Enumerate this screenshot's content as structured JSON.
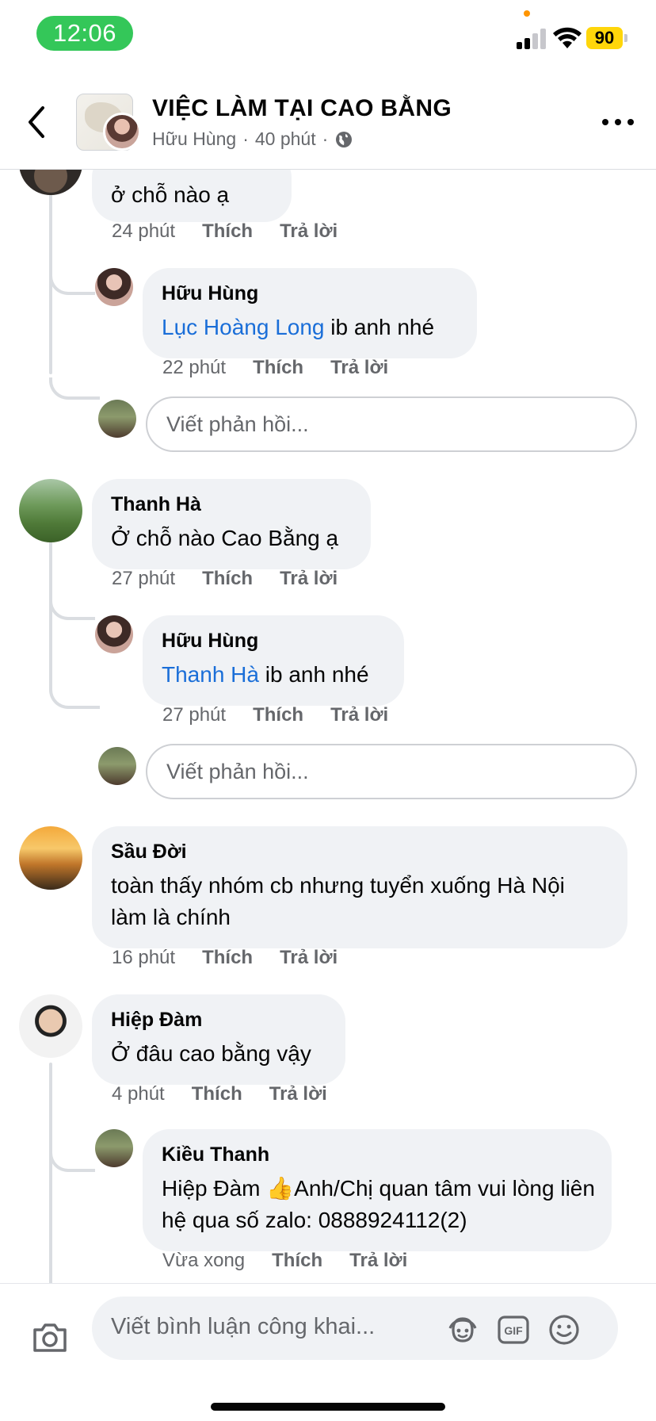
{
  "status_bar": {
    "time": "12:06",
    "battery": "90"
  },
  "header": {
    "title": "VIỆC LÀM TẠI CAO BẰNG",
    "author": "Hữu Hùng",
    "separator": "·",
    "time_ago": "40 phút",
    "separator2": "·"
  },
  "comments": {
    "c0": {
      "text": "ở chỗ nào ạ",
      "time": "24 phút",
      "like": "Thích",
      "reply": "Trả lời"
    },
    "r0": {
      "author": "Hữu Hùng",
      "mention": "Lục Hoàng Long",
      "text": " ib anh nhé",
      "time": "22 phút",
      "like": "Thích",
      "reply": "Trả lời"
    },
    "reply_box_1": {
      "placeholder": "Viết phản hồi..."
    },
    "c1": {
      "author": "Thanh Hà",
      "text": "Ở chỗ nào Cao Bằng ạ",
      "time": "27 phút",
      "like": "Thích",
      "reply": "Trả lời"
    },
    "r1": {
      "author": "Hữu Hùng",
      "mention": "Thanh Hà",
      "text": " ib anh nhé",
      "time": "27 phút",
      "like": "Thích",
      "reply": "Trả lời"
    },
    "reply_box_2": {
      "placeholder": "Viết phản hồi..."
    },
    "c2": {
      "author": "Sầu Đời",
      "text": "toàn thấy nhóm cb nhưng tuyển xuống Hà Nội làm là chính",
      "time": "16 phút",
      "like": "Thích",
      "reply": "Trả lời"
    },
    "c3": {
      "author": "Hiệp Đàm",
      "text": "Ở đâu cao bằng vậy",
      "time": "4 phút",
      "like": "Thích",
      "reply": "Trả lời"
    },
    "r3": {
      "author": "Kiều Thanh",
      "text_before": "Hiệp Đàm ",
      "emoji": "👍",
      "text_after": "Anh/Chị quan tâm vui lòng liên hệ qua số zalo: 0888924112(2)",
      "time": "Vừa xong",
      "like": "Thích",
      "reply": "Trả lời"
    }
  },
  "composer": {
    "placeholder": "Viết bình luận công khai..."
  },
  "colors": {
    "mention": "#1a6ed8",
    "bubble": "#f0f2f5",
    "meta": "#65676b",
    "status_green": "#34c759",
    "battery": "#ffd60a"
  }
}
